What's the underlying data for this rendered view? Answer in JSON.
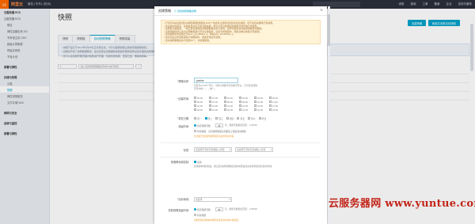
{
  "topbar": {
    "logo_mark": "[-]",
    "logo_text": "阿里云",
    "nav": "管控 | 华东1 (杭州)",
    "right_items": [
      "消息",
      "费用",
      "工单",
      "备案",
      "企业",
      "支持与服务"
    ]
  },
  "sidebar": {
    "items": [
      {
        "label": "云服务器 ECS",
        "kind": "group"
      },
      {
        "label": "云服务器 ECS",
        "kind": "item"
      },
      {
        "label": "概览",
        "kind": "sub"
      },
      {
        "label": "弹性容器实例 ECI",
        "kind": "sub"
      },
      {
        "label": "专有宿主机 DDH",
        "kind": "sub"
      },
      {
        "label": "超级计算集群",
        "kind": "sub"
      },
      {
        "label": "预留实例券",
        "kind": "sub"
      },
      {
        "label": "节省计划",
        "kind": "sub"
      },
      {
        "label": "",
        "kind": "gap"
      },
      {
        "label": "部署与弹性",
        "kind": "group"
      },
      {
        "label": "",
        "kind": "gap"
      },
      {
        "label": "存储与快照",
        "kind": "group"
      },
      {
        "label": "云盘",
        "kind": "sub"
      },
      {
        "label": "快照",
        "kind": "sub",
        "active": true
      },
      {
        "label": "弹性快照服务",
        "kind": "sub"
      },
      {
        "label": "文件存储 NAS",
        "kind": "sub"
      },
      {
        "label": "",
        "kind": "gap"
      },
      {
        "label": "网络与安全",
        "kind": "group"
      },
      {
        "label": "",
        "kind": "gap"
      },
      {
        "label": "运维与监控",
        "kind": "group"
      },
      {
        "label": "",
        "kind": "gap"
      },
      {
        "label": "部署与弹性",
        "kind": "group"
      }
    ]
  },
  "main": {
    "title": "快照",
    "tabs": [
      "快照",
      "快照链",
      "自动快照策略",
      "快照容量"
    ],
    "active_tab": 2,
    "notice": [
      "• 快照产品已于2017年3月28日正式商业化，7月1日起按快照占用的存储容量收费。",
      "• 如果您开启了快照数据服务，建议您按业务数据和快照操作更新频率设置合理的快照策略。",
      "• 您可以在快照管理页面对快照进行管理，包括创建快照、回滚云盘、删除快照等。"
    ],
    "filter_placeholder": "输入自动快照策略名称或ID进行搜索",
    "buttons": [
      "创建策略",
      "刷新并设置自动快照"
    ]
  },
  "modal": {
    "title": "创建策略",
    "help": "① 自动快照策略说明",
    "close": "×",
    "warning": [
      "• 已对同1块设置的自动快照保留数量超过1000个将会停止继续创建新的自动快照，但不会自动删除已有快照。",
      "• 在设置的时间点，系统会自动为云盘创建快照，部分业务高峰期创建快照可能影响云盘性能。",
      "• 设置最大数量后，一块云盘创建的自动快照数量达到上限时，最早创建的自动快照将被自动删除。",
      "• 创建快照时默认会对全部数据进行首次全量备份，后续为增量备份，费用请参见快照计费说明。",
      "• 自动快照的命名格式为auto_yyyyMMdd_1，例如auto_20140418_1。",
      "• 建议您在业务低峰期执行快照操作，避免影响业务使用。",
      "• 自动快照策略最多可配置40个，请合理使用。"
    ],
    "name_label": "*策略名称:",
    "name_value": "yuntue",
    "name_hint": "长度为2-128个字符，不能以特殊字符及数字开头，只可包含特殊字符中的\".\"，\"_\"或\"-\"。",
    "time_label": "*创建时间:",
    "hours": [
      "00:00",
      "01:00",
      "02:00",
      "03:00",
      "04:00",
      "05:00",
      "06:00",
      "07:00",
      "08:00",
      "09:00",
      "10:00",
      "11:00",
      "12:00",
      "13:00",
      "14:00",
      "15:00",
      "16:00",
      "17:00",
      "18:00",
      "19:00",
      "20:00",
      "21:00",
      "22:00",
      "23:00"
    ],
    "repeat_label": "*重复日期:",
    "days": [
      "周一",
      "周二",
      "周三",
      "周四",
      "周五",
      "周六",
      "周日"
    ],
    "days_on": [
      false,
      true,
      false,
      false,
      false,
      false,
      false
    ],
    "retain_label": "保留时间:",
    "retain_opt1": "指定保留天数",
    "retain_days": "30",
    "retain_unit": "天，保留天数取值范围：1-65536",
    "retain_opt2": "持续保留，直到快照数量达到额度上限后自动删除",
    "retain_note": "您当前已使用的快照额度请在控制台查看",
    "region_label": "标签:",
    "select1": "请选择已有标签键或输入新键",
    "select2": "请选择已有标签值或输入新值",
    "copy_label": "快照跨地域复制:",
    "copy_opt": "启用",
    "copy_hint": "启用跨地域复制后，通过自动快照策略创建的快照会自动复制到指定的目标地域。",
    "target_label": "*目标地域:",
    "target_select": "请选择",
    "copy_retain_label": "复制快照保留时间:",
    "copy_retain_opt1": "指定保留天数",
    "copy_retain_days": "30",
    "copy_retain_unit": "天，保留天数取值范围：1-65536",
    "copy_retain_opt2": "持续保留",
    "copy_retain_note": "复制到目标地域的快照将按目标地域价格收费。"
  },
  "watermark": "云服务器网 www.yuntue.com"
}
